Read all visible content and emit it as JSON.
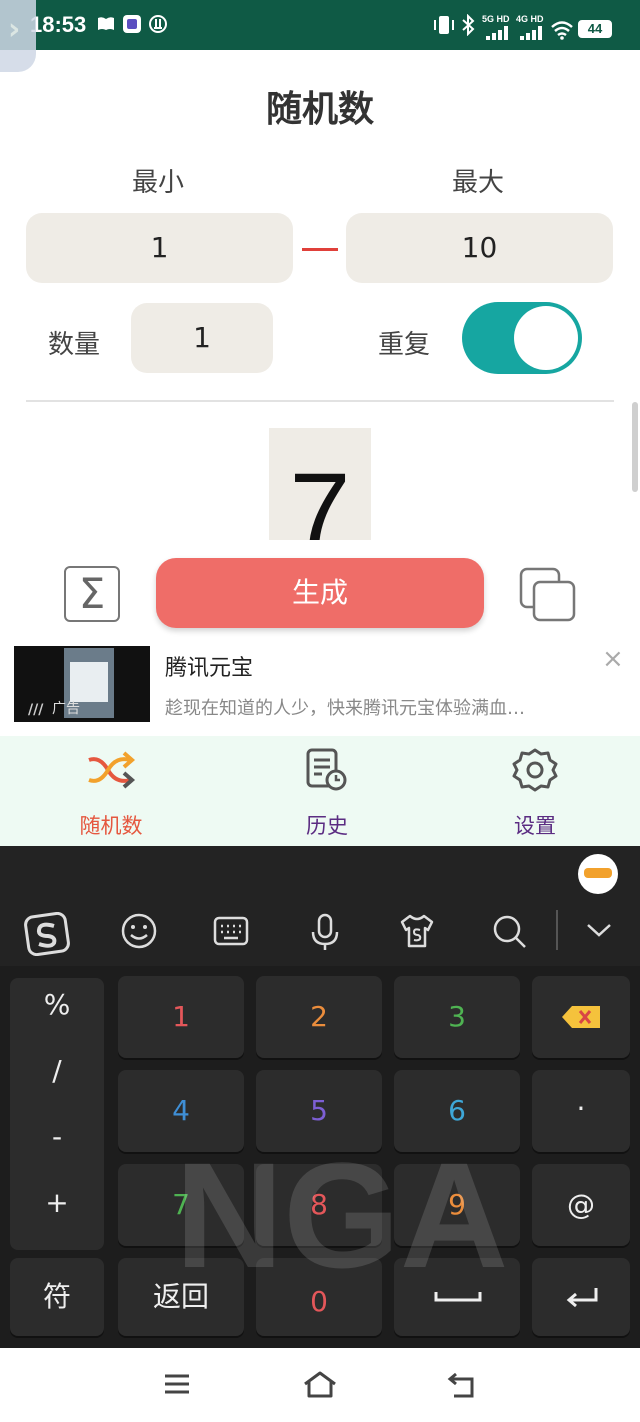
{
  "status_bar": {
    "time": "18:53",
    "net1": "5G HD",
    "net2": "4G HD",
    "battery": "44",
    "icons": [
      "book-icon",
      "app-badge-icon",
      "data-saver-icon",
      "vibrate-icon",
      "bluetooth-icon",
      "signal-icon",
      "wifi-icon"
    ]
  },
  "app": {
    "title": "随机数",
    "min_label": "最小",
    "max_label": "最大",
    "min_value": "1",
    "max_value": "10",
    "count_label": "数量",
    "count_value": "1",
    "repeat_label": "重复",
    "repeat_enabled": true,
    "result": "7",
    "sum_symbol": "Σ",
    "generate_label": "生成",
    "accent_color": "#ef6d68",
    "toggle_color": "#16a6a1"
  },
  "ad": {
    "title": "腾讯元宝",
    "description": "趁现在知道的人少，快来腾讯元宝体验满血…",
    "tag": "广告",
    "close": "×"
  },
  "bottom_nav": {
    "items": [
      {
        "label": "随机数",
        "icon": "shuffle-icon",
        "color": "#e5573f",
        "active": true
      },
      {
        "label": "历史",
        "icon": "history-icon",
        "color": "#5b2c82",
        "active": false
      },
      {
        "label": "设置",
        "icon": "settings-icon",
        "color": "#5b2c82",
        "active": false
      }
    ]
  },
  "keyboard": {
    "symbols": [
      "%",
      "/",
      "-",
      "+"
    ],
    "row1": [
      {
        "label": "1",
        "color": "#e4575a"
      },
      {
        "label": "2",
        "color": "#eb8d3c"
      },
      {
        "label": "3",
        "color": "#4fb352"
      }
    ],
    "row2": [
      {
        "label": "4",
        "color": "#3f8fd6"
      },
      {
        "label": "5",
        "color": "#7d5fd4"
      },
      {
        "label": "6",
        "color": "#3ea7d8"
      }
    ],
    "row3": [
      {
        "label": "7",
        "color": "#4fb352"
      },
      {
        "label": "8",
        "color": "#e4575a"
      },
      {
        "label": "9",
        "color": "#eb8d3c"
      }
    ],
    "dot": "·",
    "at": "@",
    "fu": "符",
    "back": "返回",
    "zero": "0",
    "zero_color": "#e4575a",
    "watermark": "NGA"
  }
}
